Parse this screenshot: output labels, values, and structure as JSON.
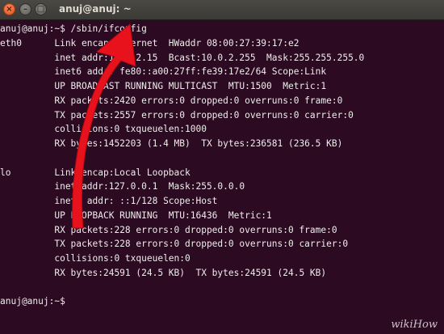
{
  "window": {
    "title": "anuj@anuj: ~",
    "close_glyph": "×",
    "minimize_glyph": "–",
    "maximize_glyph": "□"
  },
  "terminal": {
    "lines": [
      "anuj@anuj:~$ /sbin/ifconfig",
      "eth0      Link encap:Ethernet  HWaddr 08:00:27:39:17:e2",
      "          inet addr:10.0.2.15  Bcast:10.0.2.255  Mask:255.255.255.0",
      "          inet6 addr: fe80::a00:27ff:fe39:17e2/64 Scope:Link",
      "          UP BROADCAST RUNNING MULTICAST  MTU:1500  Metric:1",
      "          RX packets:2420 errors:0 dropped:0 overruns:0 frame:0",
      "          TX packets:2557 errors:0 dropped:0 overruns:0 carrier:0",
      "          collisions:0 txqueuelen:1000",
      "          RX bytes:1452203 (1.4 MB)  TX bytes:236581 (236.5 KB)",
      "",
      "lo        Link encap:Local Loopback",
      "          inet addr:127.0.0.1  Mask:255.0.0.0",
      "          inet6 addr: ::1/128 Scope:Host",
      "          UP LOOPBACK RUNNING  MTU:16436  Metric:1",
      "          RX packets:228 errors:0 dropped:0 overruns:0 frame:0",
      "          TX packets:228 errors:0 dropped:0 overruns:0 carrier:0",
      "          collisions:0 txqueuelen:0",
      "          RX bytes:24591 (24.5 KB)  TX bytes:24591 (24.5 KB)",
      "",
      "anuj@anuj:~$ "
    ]
  },
  "watermark": "wikiHow",
  "colors": {
    "terminal_bg": "#2c0a22",
    "terminal_fg": "#eeeeec",
    "arrow": "#e8121c"
  }
}
